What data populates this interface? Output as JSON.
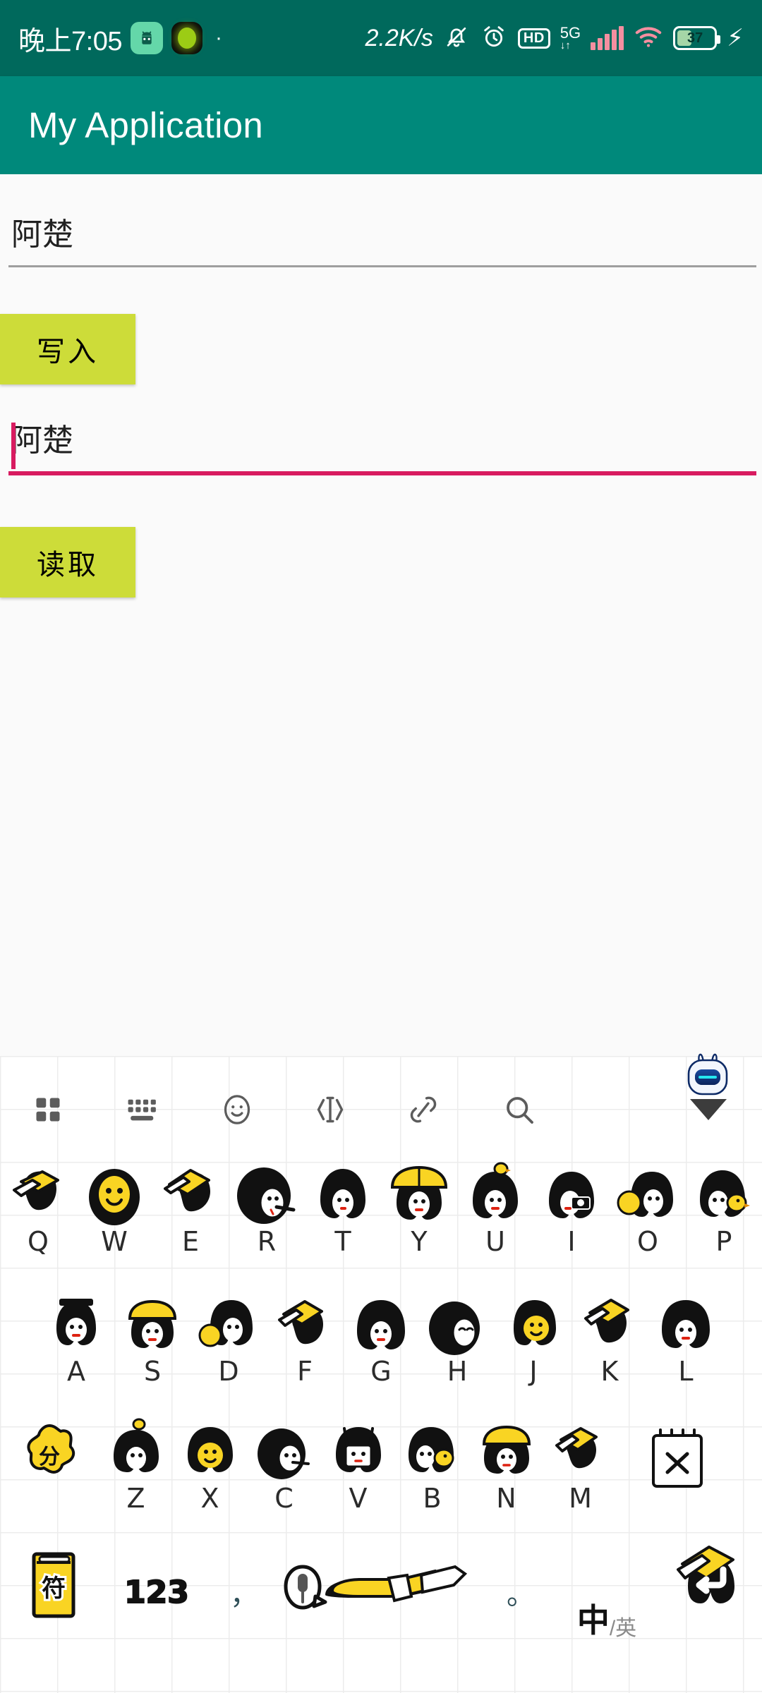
{
  "status_bar": {
    "time": "晚上7:05",
    "android_icon": "android-robot-icon",
    "dot_icon": "green-dot-indicator-icon",
    "separator": "·",
    "network_speed": "2.2K/s",
    "mute_icon": "bell-muted-icon",
    "alarm_icon": "alarm-clock-icon",
    "hd_label": "HD",
    "network_type": "5G",
    "network_sub": "↓↑",
    "signal_icon": "signal-bars-icon",
    "wifi_icon": "wifi-icon",
    "battery_percent": "37",
    "charging_icon": "lightning-bolt-icon"
  },
  "app_bar": {
    "title": "My Application"
  },
  "main": {
    "input_field": {
      "value": "阿楚",
      "placeholder": ""
    },
    "write_button": {
      "label": "写入"
    },
    "output_field": {
      "value": "阿楚",
      "placeholder": "",
      "focused": true
    },
    "read_button": {
      "label": "读取"
    }
  },
  "floating": {
    "assistant_icon": "robot-assistant-icon"
  },
  "keyboard": {
    "toolbar": [
      {
        "name": "grid-apps-icon",
        "label": ""
      },
      {
        "name": "keyboard-layout-icon",
        "label": ""
      },
      {
        "name": "emoji-smiley-icon",
        "label": ""
      },
      {
        "name": "text-cursor-edit-icon",
        "label": ""
      },
      {
        "name": "clip-link-icon",
        "label": ""
      },
      {
        "name": "search-icon",
        "label": ""
      },
      {
        "name": "chevron-down-icon",
        "label": ""
      }
    ],
    "rows": [
      {
        "name": "row-qwerty",
        "keys": [
          {
            "label": "Q",
            "art": "doodle-yellow-book-girl"
          },
          {
            "label": "W",
            "art": "doodle-smiley-face-girl"
          },
          {
            "label": "E",
            "art": "doodle-yellow-book-girl-2"
          },
          {
            "label": "R",
            "art": "doodle-afro-girl-white-face"
          },
          {
            "label": "T",
            "art": "doodle-bob-hair-girl"
          },
          {
            "label": "Y",
            "art": "doodle-yellow-hat-girl"
          },
          {
            "label": "U",
            "art": "doodle-duck-hair-girl"
          },
          {
            "label": "I",
            "art": "doodle-camera-girl"
          },
          {
            "label": "O",
            "art": "doodle-yellow-ball-girl"
          },
          {
            "label": "P",
            "art": "doodle-duckling-girl"
          }
        ]
      },
      {
        "name": "row-asdf",
        "keys": [
          {
            "label": "A",
            "art": "doodle-jar-girl"
          },
          {
            "label": "S",
            "art": "doodle-yellow-cap-girl"
          },
          {
            "label": "D",
            "art": "doodle-yellow-ball-girl-2"
          },
          {
            "label": "F",
            "art": "doodle-yellow-flag-girl"
          },
          {
            "label": "G",
            "art": "doodle-long-hair-girl"
          },
          {
            "label": "H",
            "art": "doodle-sleeping-girl"
          },
          {
            "label": "J",
            "art": "doodle-smiley-yellow-girl"
          },
          {
            "label": "K",
            "art": "doodle-yellow-book-girl-3"
          },
          {
            "label": "L",
            "art": "doodle-pigtail-girl"
          }
        ]
      },
      {
        "name": "row-zxcv",
        "keys": [
          {
            "label": "",
            "art": "shift-flower-icon",
            "name": "shift-key"
          },
          {
            "label": "Z",
            "art": "doodle-duck-head-girl"
          },
          {
            "label": "X",
            "art": "doodle-smiley-girl-2"
          },
          {
            "label": "C",
            "art": "doodle-white-face-girl"
          },
          {
            "label": "V",
            "art": "doodle-frame-girl"
          },
          {
            "label": "B",
            "art": "doodle-duckling-girl-2"
          },
          {
            "label": "N",
            "art": "doodle-yellow-hat-girl-2"
          },
          {
            "label": "M",
            "art": "doodle-yellow-flag-girl-2"
          },
          {
            "label": "",
            "art": "backspace-notepad-icon",
            "name": "backspace-key"
          }
        ]
      },
      {
        "name": "row-bottom",
        "keys": [
          {
            "label": "符",
            "art": "symbol-book-icon",
            "name": "symbol-key"
          },
          {
            "label": "123",
            "art": "",
            "name": "numeric-key"
          },
          {
            "label": "，",
            "art": "",
            "name": "comma-key"
          },
          {
            "label": "",
            "art": "mic-spacebar-icon",
            "name": "space-key"
          },
          {
            "label": "。",
            "art": "",
            "name": "period-key"
          },
          {
            "label": "中",
            "sublabel": "/英",
            "art": "",
            "name": "language-toggle-key"
          },
          {
            "label": "",
            "art": "enter-doodle-icon",
            "name": "enter-key"
          }
        ]
      }
    ]
  },
  "colors": {
    "status_bar_bg": "#00695C",
    "app_bar_bg": "#00897B",
    "button_bg": "#CDDC39",
    "focus_underline": "#D81B60",
    "content_bg": "#FAFAFA",
    "doodle_yellow": "#F9D423",
    "signal_pink": "#F48FA0"
  }
}
